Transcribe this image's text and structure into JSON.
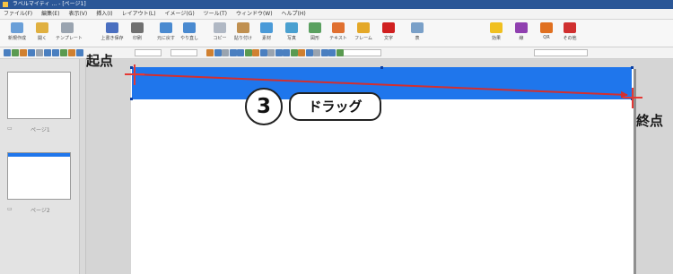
{
  "window": {
    "title": "ラベルマイティ … - [ページ1]"
  },
  "menu": {
    "items": [
      "ファイル(F)",
      "編集(E)",
      "表示(V)",
      "挿入(I)",
      "レイアウト(L)",
      "イメージ(G)",
      "ツール(T)",
      "ウィンドウ(W)",
      "ヘルプ(H)"
    ]
  },
  "toolbar": {
    "tools": [
      {
        "name": "new",
        "label": "新規作成",
        "color": "#6a9fd8"
      },
      {
        "name": "open",
        "label": "開く",
        "color": "#e0b040"
      },
      {
        "name": "template",
        "label": "テンプレート",
        "color": "#9aa4b0"
      },
      {
        "name": "save",
        "label": "上書き保存",
        "color": "#4a6fc0"
      },
      {
        "name": "print",
        "label": "印刷",
        "color": "#707070"
      },
      {
        "name": "undo",
        "label": "元に戻す",
        "color": "#4a8ad0"
      },
      {
        "name": "redo",
        "label": "やり直し",
        "color": "#4a8ad0"
      },
      {
        "name": "copy",
        "label": "コピー",
        "color": "#b0b8c4"
      },
      {
        "name": "paste",
        "label": "貼り付け",
        "color": "#c09050"
      },
      {
        "name": "clipart",
        "label": "素材",
        "color": "#4a9ad8"
      },
      {
        "name": "photo",
        "label": "写真",
        "color": "#4aa0d0"
      },
      {
        "name": "shape",
        "label": "図形",
        "color": "#5aa060"
      },
      {
        "name": "text",
        "label": "テキスト",
        "color": "#e07030"
      },
      {
        "name": "frame",
        "label": "フレーム",
        "color": "#e4a828"
      },
      {
        "name": "letter",
        "label": "文字",
        "color": "#d02020"
      },
      {
        "name": "table",
        "label": "表",
        "color": "#7aa0c8"
      },
      {
        "name": "effect",
        "label": "効果",
        "color": "#f0c020"
      },
      {
        "name": "line",
        "label": "線",
        "color": "#9040b0"
      },
      {
        "name": "qr",
        "label": "QR",
        "color": "#e07020"
      },
      {
        "name": "more",
        "label": "その他",
        "color": "#d03030"
      }
    ]
  },
  "thumbnails": {
    "page1_label": "ページ1",
    "page2_label": "ページ2"
  },
  "annotations": {
    "start_point": "起点",
    "end_point": "終点",
    "step_number": "3",
    "step_label": "ドラッグ"
  },
  "colors": {
    "drawn_rectangle": "#1f76ec",
    "arrow": "#d32f2f"
  }
}
